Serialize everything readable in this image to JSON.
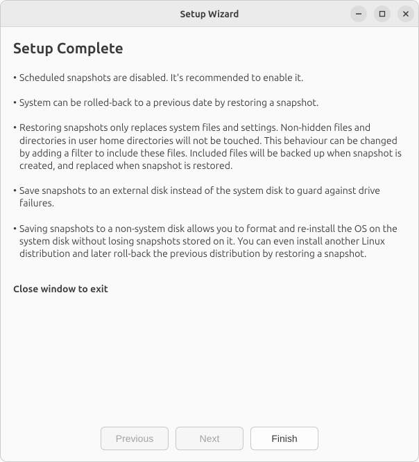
{
  "window": {
    "title": "Setup Wizard"
  },
  "main": {
    "heading": "Setup Complete",
    "bullets": [
      "Scheduled snapshots are disabled. It's recommended to enable it.",
      "System can be rolled-back to a previous date by restoring a snapshot.",
      "Restoring snapshots only replaces system files and settings. Non-hidden files and directories in user home directories will not be touched. This behaviour can be changed by adding a filter to include these files. Included files will be backed up when snapshot is created, and replaced when snapshot is restored.",
      "Save snapshots to an external disk instead of the system disk to guard against drive failures.",
      "Saving snapshots to a non-system disk allows you to format and re-install the OS on the system disk without losing snapshots stored on it. You can even install another Linux distribution and later roll-back the previous distribution by restoring a snapshot."
    ],
    "close_msg": "Close window to exit"
  },
  "footer": {
    "previous": "Previous",
    "next": "Next",
    "finish": "Finish"
  }
}
